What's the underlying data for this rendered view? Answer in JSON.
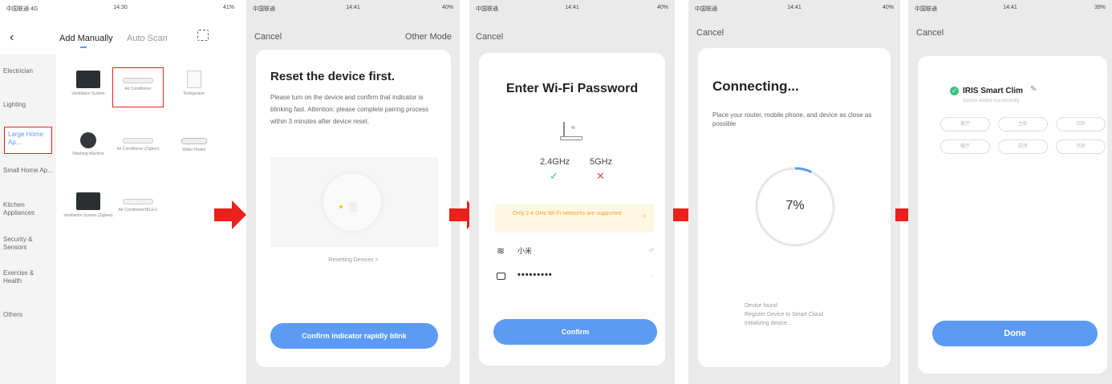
{
  "colors": {
    "accent": "#5b9bf3",
    "arrow": "#e8221c",
    "success": "#3cc07a",
    "error": "#e84c4c",
    "warn": "#f5a623"
  },
  "s1": {
    "status": {
      "left": "中国联通 4G",
      "time": "14:30",
      "right": "41%"
    },
    "tabs": {
      "manual": "Add Manually",
      "auto": "Auto Scan"
    },
    "sidebar": [
      "Electrician",
      "Lighting",
      "Large Home Ap...",
      "Small Home Ap...",
      "Kitchen Appliances",
      "Security & Sensors",
      "Exercise & Health",
      "Others"
    ],
    "devices": [
      "Ventilation System",
      "Air Conditioner",
      "Refrigerator",
      "Washing Machine",
      "Air Conditioner (Zigbee)",
      "Water Heater",
      "Ventilation System (Zigbee)",
      "Air Conditioner(BLE+)"
    ]
  },
  "s2": {
    "status": {
      "left": "中国联通",
      "time": "14:41",
      "right": "40%"
    },
    "cancel": "Cancel",
    "other": "Other Mode",
    "title": "Reset the device first.",
    "body": "Please turn on the device and confirm that indicator is blinking fast. Attention: please complete pairing process within 3 minutes after device reset.",
    "link": "Resetting Devices >",
    "button": "Confirm indicator rapidly blink"
  },
  "s3": {
    "status": {
      "left": "中国联通",
      "time": "14:41",
      "right": "40%"
    },
    "cancel": "Cancel",
    "title": "Enter Wi-Fi Password",
    "band24": "2.4GHz",
    "band5": "5GHz",
    "warning": "Only 2.4 GHz Wi-Fi networks are supported",
    "ssid": "小米",
    "password": "•••••••••",
    "button": "Confirm"
  },
  "s4": {
    "status": {
      "left": "中国联通",
      "time": "14:41",
      "right": "40%"
    },
    "cancel": "Cancel",
    "title": "Connecting...",
    "body": "Place your router, mobile phone, and device as close as possible",
    "progress": 7,
    "progress_label": "7%",
    "steps": [
      "Device found",
      "Register Device to Smart Cloud",
      "Initializing device..."
    ]
  },
  "s5": {
    "status": {
      "left": "中国联通",
      "time": "14:41",
      "right": "39%"
    },
    "cancel": "Cancel",
    "device_name": "IRIS Smart Clim",
    "added": "Device added successfully",
    "rooms": [
      "客厅",
      "主卧",
      "次卧",
      "餐厅",
      "厨房",
      "书房"
    ],
    "button": "Done"
  }
}
